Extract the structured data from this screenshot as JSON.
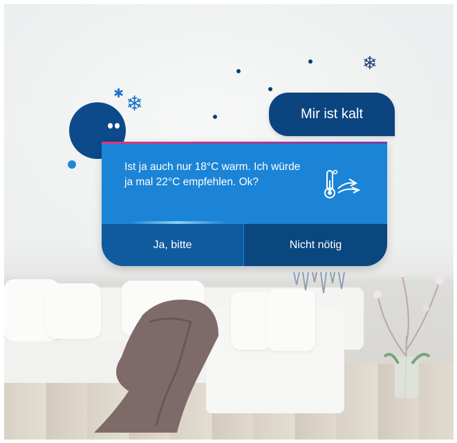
{
  "assistant": {
    "message": "Ist ja auch nur 18°C warm. Ich würde ja mal 22°C empfehlen. Ok?",
    "icon": "thermometer-airflow-icon"
  },
  "user": {
    "message": "Mir ist kalt"
  },
  "actions": {
    "yes_label": "Ja, bitte",
    "no_label": "Nicht nötig"
  },
  "colors": {
    "card": "#1b84d6",
    "card_dark": "#0b477f",
    "user_bubble": "#0c4480",
    "accent_line": "#e5337a"
  }
}
